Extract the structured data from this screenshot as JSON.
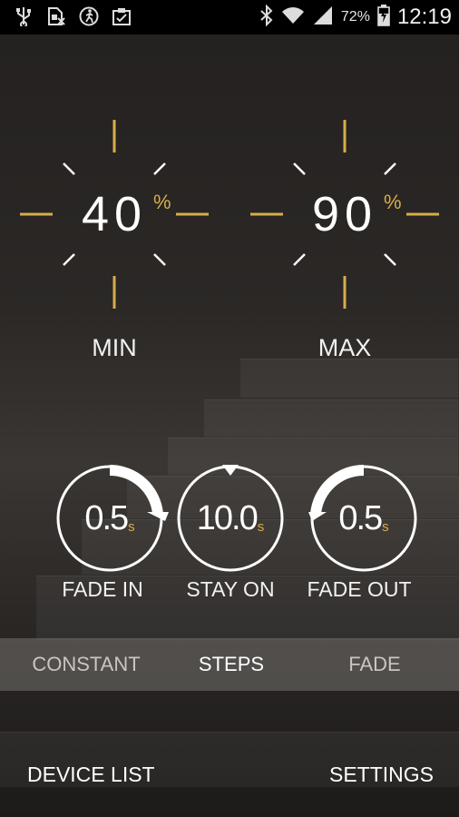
{
  "status_bar": {
    "left_icons": [
      "usb-icon",
      "sim-blocked-icon",
      "running-icon",
      "clipboard-icon"
    ],
    "battery_percent": "72%",
    "time": "12:19"
  },
  "dials": [
    {
      "value": "40",
      "unit": "%",
      "label": "MIN"
    },
    {
      "value": "90",
      "unit": "%",
      "label": "MAX"
    }
  ],
  "timers": [
    {
      "value": "0.5",
      "unit": "s",
      "label": "FADE IN"
    },
    {
      "value": "10.0",
      "unit": "s",
      "label": "STAY ON"
    },
    {
      "value": "0.5",
      "unit": "s",
      "label": "FADE OUT"
    }
  ],
  "modes": [
    {
      "label": "CONSTANT",
      "selected": false
    },
    {
      "label": "STEPS",
      "selected": true
    },
    {
      "label": "FADE",
      "selected": false
    }
  ],
  "bottom": {
    "device_list": "DEVICE LIST",
    "settings": "SETTINGS"
  },
  "colors": {
    "accent": "#d7ad4a",
    "text": "#ffffff",
    "inactive": "#c9c6c2"
  }
}
